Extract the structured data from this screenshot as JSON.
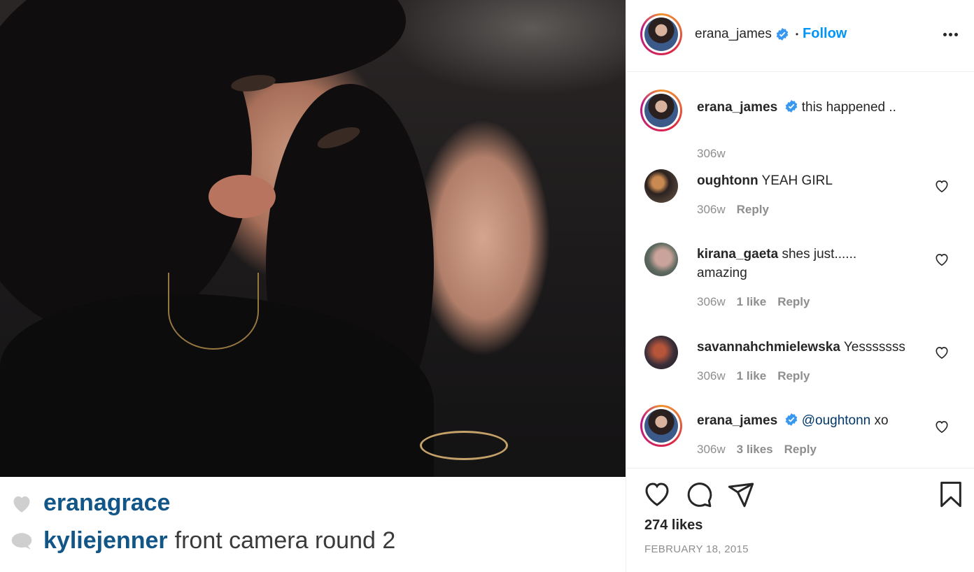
{
  "header": {
    "username": "erana_james",
    "separator": "•",
    "follow_label": "Follow"
  },
  "post_image": {
    "caption_lines": [
      {
        "icon": "heart-icon",
        "user": "eranagrace",
        "text": ""
      },
      {
        "icon": "comment-icon",
        "user": "kyliejenner",
        "text": "front camera round 2"
      }
    ]
  },
  "comments": [
    {
      "user": "erana_james",
      "verified": true,
      "text": "this happened ..",
      "age": "306w",
      "likes": "",
      "reply": ""
    },
    {
      "user": "oughtonn",
      "verified": false,
      "text": "YEAH GIRL",
      "age": "306w",
      "likes": "",
      "reply": "Reply"
    },
    {
      "user": "kirana_gaeta",
      "verified": false,
      "text": "shes just...... amazing",
      "age": "306w",
      "likes": "1 like",
      "reply": "Reply"
    },
    {
      "user": "savannahchmielewska",
      "verified": false,
      "text": "Yesssssss",
      "age": "306w",
      "likes": "1 like",
      "reply": "Reply"
    },
    {
      "user": "erana_james",
      "verified": true,
      "mention": "@oughtonn",
      "text": "xo",
      "age": "306w",
      "likes": "3 likes",
      "reply": "Reply"
    }
  ],
  "footer": {
    "likes": "274 likes",
    "date": "FEBRUARY 18, 2015"
  },
  "colors": {
    "accent": "#0095f6",
    "verified": "#3897f0",
    "muted": "#8e8e8e",
    "caption_user": "#125688"
  }
}
